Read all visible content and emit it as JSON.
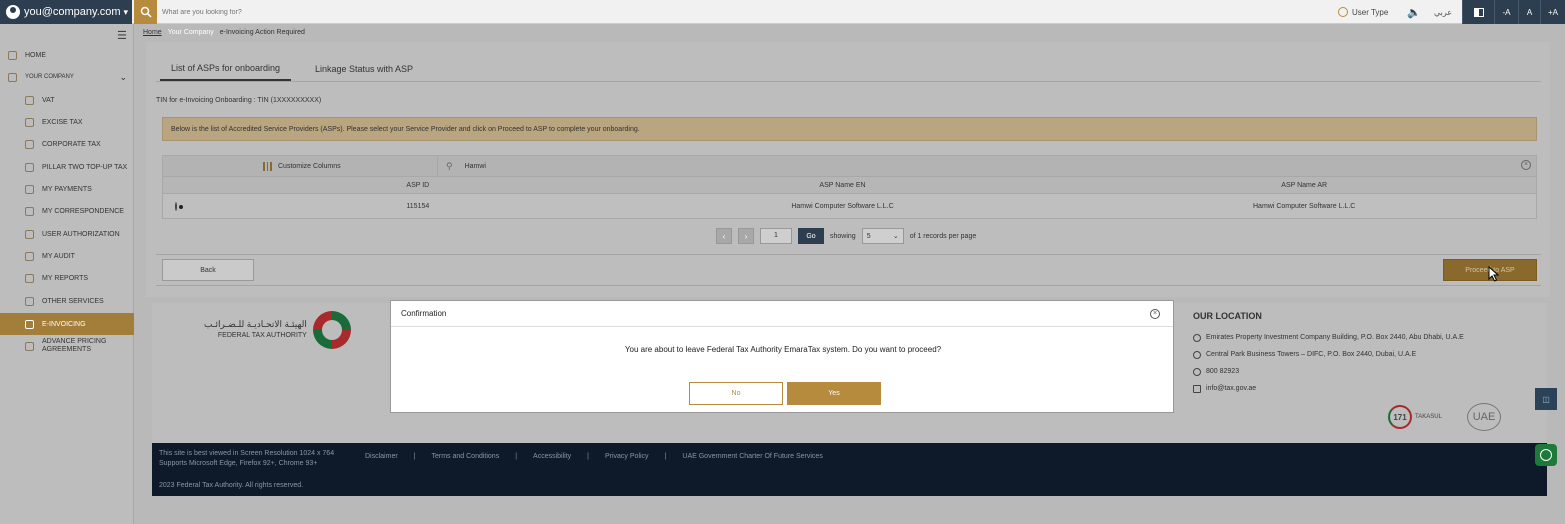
{
  "topbar": {
    "user_email": "you@company.com",
    "search_placeholder": "What are you looking for?",
    "user_type_label": "User Type",
    "language_label": "عربي",
    "font_decrease": "-A",
    "font_reset": "A",
    "font_increase": "+A"
  },
  "sidebar": {
    "items": [
      {
        "label": "HOME"
      },
      {
        "label": "YOUR COMPANY"
      },
      {
        "label": "VAT"
      },
      {
        "label": "EXCISE TAX"
      },
      {
        "label": "CORPORATE TAX"
      },
      {
        "label": "PILLAR TWO TOP-UP TAX"
      },
      {
        "label": "MY PAYMENTS"
      },
      {
        "label": "MY CORRESPONDENCE"
      },
      {
        "label": "USER AUTHORIZATION"
      },
      {
        "label": "MY AUDIT"
      },
      {
        "label": "MY REPORTS"
      },
      {
        "label": "OTHER SERVICES"
      },
      {
        "label": "E-INVOICING"
      },
      {
        "label": "ADVANCE PRICING AGREEMENTS"
      }
    ]
  },
  "breadcrumb": {
    "home": "Home",
    "company": "Your Company",
    "current": "e-Invoicing Action Required"
  },
  "tabs": [
    {
      "label": "List of ASPs for onboarding"
    },
    {
      "label": "Linkage Status with ASP"
    }
  ],
  "tin_label": "TIN for e-Invoicing Onboarding : TIN (1XXXXXXXXX)",
  "notice": "Below is the list of Accredited Service Providers (ASPs). Please select your Service Provider and click on Proceed to ASP to complete your onboarding.",
  "table": {
    "customize_label": "Customize Columns",
    "search_value": "Hamwi",
    "headers": [
      "",
      "ASP ID",
      "ASP Name EN",
      "ASP Name AR"
    ],
    "rows": [
      {
        "id": "115154",
        "name_en": "Hamwi Computer Software L.L.C",
        "name_ar": "Hamwi Computer Software L.L.C"
      }
    ]
  },
  "pager": {
    "page": "1",
    "go": "Go",
    "showing": "showing",
    "per_page": "5",
    "records": "of 1 records per page"
  },
  "actions": {
    "back": "Back",
    "proceed": "Proceed to ASP"
  },
  "footer": {
    "logo_ar": "الهيئـة الاتحـاديـة للـضـرائـب",
    "logo_en": "FEDERAL TAX AUTHORITY",
    "location_title": "OUR LOCATION",
    "address1": "Emirates Property Investment Company Building, P.O. Box 2440, Abu Dhabi, U.A.E",
    "address2": "Central Park Business Towers – DIFC, P.O. Box 2440, Dubai, U.A.E",
    "phone": "800 82923",
    "email": "info@tax.gov.ae",
    "badge_num": "171",
    "badge_text": "TAKASUL",
    "uae_logo": "UAE",
    "resolution1": "This site is best viewed in Screen Resolution 1024 x 764",
    "resolution2": "Supports Microsoft Edge, Firefox 92+, Chrome 93+",
    "links": [
      "Disclaimer",
      "Terms and Conditions",
      "Accessibility",
      "Privacy Policy",
      "UAE Government Charter Of Future Services"
    ],
    "copyright": "2023 Federal Tax Authority. All rights reserved."
  },
  "modal": {
    "title": "Confirmation",
    "message": "You are about to leave Federal Tax Authority EmaraTax system. Do you want to proceed?",
    "no": "No",
    "yes": "Yes"
  }
}
